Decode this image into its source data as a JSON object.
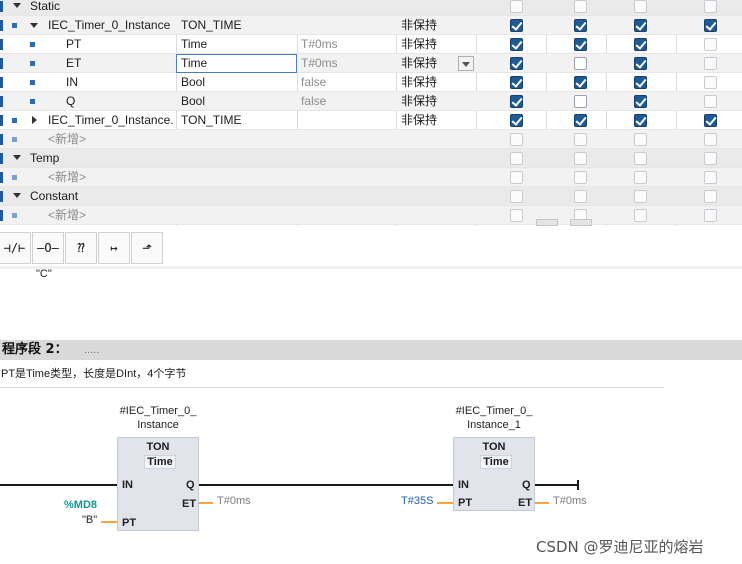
{
  "variable_table": {
    "rows": [
      {
        "name": "Static",
        "type": "",
        "value": "",
        "retain": "",
        "kind": "section",
        "cb": [
          null,
          null,
          null,
          null
        ]
      },
      {
        "name": "IEC_Timer_0_Instance",
        "type": "TON_TIME",
        "value": "",
        "retain": "非保持",
        "kind": "expanded",
        "cb": [
          true,
          true,
          true,
          true
        ]
      },
      {
        "name": "PT",
        "type": "Time",
        "value": "T#0ms",
        "retain": "非保持",
        "kind": "child",
        "cb": [
          true,
          true,
          true,
          null
        ]
      },
      {
        "name": "ET",
        "type": "Time",
        "value": "T#0ms",
        "retain": "非保持",
        "kind": "child-edit",
        "cb": [
          true,
          false,
          true,
          null
        ]
      },
      {
        "name": "IN",
        "type": "Bool",
        "value": "false",
        "retain": "非保持",
        "kind": "child",
        "cb": [
          true,
          true,
          true,
          null
        ]
      },
      {
        "name": "Q",
        "type": "Bool",
        "value": "false",
        "retain": "非保持",
        "kind": "child",
        "cb": [
          true,
          false,
          true,
          null
        ]
      },
      {
        "name": "IEC_Timer_0_Instance...",
        "type": "TON_TIME",
        "value": "",
        "retain": "非保持",
        "kind": "collapsed",
        "cb": [
          true,
          true,
          true,
          true
        ]
      },
      {
        "name": "<新增>",
        "type": "",
        "value": "",
        "retain": "",
        "kind": "new",
        "cb": [
          null,
          null,
          null,
          null
        ]
      },
      {
        "name": "Temp",
        "type": "",
        "value": "",
        "retain": "",
        "kind": "section",
        "cb": [
          null,
          null,
          null,
          null
        ]
      },
      {
        "name": "<新增>",
        "type": "",
        "value": "",
        "retain": "",
        "kind": "new",
        "cb": [
          null,
          null,
          null,
          null
        ]
      },
      {
        "name": "Constant",
        "type": "",
        "value": "",
        "retain": "",
        "kind": "section",
        "cb": [
          null,
          null,
          null,
          null
        ]
      },
      {
        "name": "<新增>",
        "type": "",
        "value": "",
        "retain": "",
        "kind": "new",
        "cb": [
          null,
          null,
          null,
          null
        ]
      }
    ]
  },
  "toolbar": {
    "buttons": [
      {
        "icon": "normally-closed-contact-icon",
        "glyph": "⊣/⊢"
      },
      {
        "icon": "coil-icon",
        "glyph": "–O–"
      },
      {
        "icon": "empty-box-icon",
        "glyph": "⁇"
      },
      {
        "icon": "open-branch-icon",
        "glyph": "↦"
      },
      {
        "icon": "close-branch-icon",
        "glyph": "⬏"
      }
    ],
    "c_label": "\"C\""
  },
  "network": {
    "title": "程序段 2：",
    "dots": ".....",
    "comment": "PT是Time类型，长度是DInt，4个字节"
  },
  "blocks": [
    {
      "instance_line1": "#IEC_Timer_0_",
      "instance_line2": "Instance",
      "title": "TON",
      "type": "Time",
      "pin_in": "IN",
      "pin_pt": "PT",
      "pin_q": "Q",
      "pin_et": "ET",
      "pt_value": "%MD8",
      "pt_symbol": "\"B\"",
      "et_value": "T#0ms"
    },
    {
      "instance_line1": "#IEC_Timer_0_",
      "instance_line2": "Instance_1",
      "title": "TON",
      "type": "Time",
      "pin_in": "IN",
      "pin_pt": "PT",
      "pin_q": "Q",
      "pin_et": "ET",
      "pt_value": "T#35S",
      "pt_symbol": "",
      "et_value": "T#0ms"
    }
  ],
  "watermark": "CSDN @罗迪尼亚的熔岩",
  "colors": {
    "checkbox_on": "#1d5a96",
    "section_bg": "#eaeaea",
    "network_header": "#d9d9d9",
    "block_fill": "#e1e4eb",
    "wire_orange": "#f3a63b",
    "pt_teal": "#139595",
    "pt_blue": "#1e5fb4"
  }
}
